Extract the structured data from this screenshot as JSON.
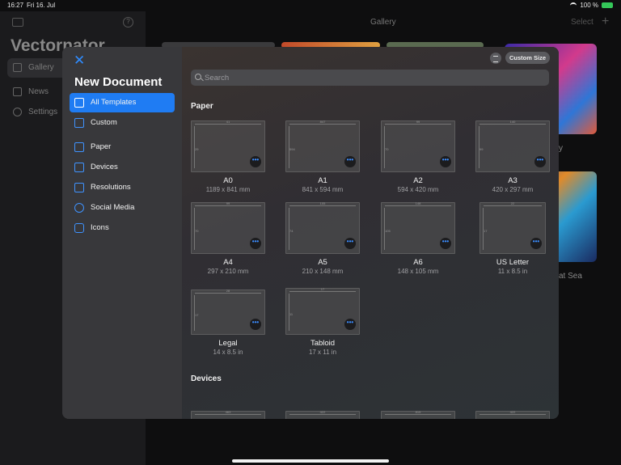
{
  "status": {
    "time": "16:27",
    "date": "Fri 16. Jul",
    "battery": "100 %"
  },
  "app": {
    "title": "Vectornator",
    "nav": [
      {
        "label": "Gallery"
      },
      {
        "label": "News"
      },
      {
        "label": "Settings"
      }
    ],
    "gallery_title": "Gallery",
    "select_label": "Select",
    "help_icon": "?",
    "plus_icon": "+",
    "partial_captions": [
      "y",
      "at Sea"
    ]
  },
  "modal": {
    "close_icon": "✕",
    "title": "New Document",
    "categories": [
      {
        "label": "All Templates",
        "icon": "grid-icon"
      },
      {
        "label": "Custom",
        "icon": "doc-icon"
      },
      {
        "label": "Paper",
        "icon": "paper-icon"
      },
      {
        "label": "Devices",
        "icon": "monitor-icon"
      },
      {
        "label": "Resolutions",
        "icon": "resolution-icon"
      },
      {
        "label": "Social Media",
        "icon": "person-icon"
      },
      {
        "label": "Icons",
        "icon": "app-icon"
      }
    ],
    "custom_size_label": "Custom Size",
    "search_placeholder": "Search",
    "sections": [
      {
        "label": "Paper"
      },
      {
        "label": "Devices"
      }
    ],
    "more_icon": "•••",
    "templates": [
      {
        "name": "A0",
        "size": "1189 x 841 mm",
        "dim_w": "41",
        "dim_h": "29"
      },
      {
        "name": "A1",
        "size": "841 x 594 mm",
        "dim_w": "847",
        "dim_h": "594"
      },
      {
        "name": "A2",
        "size": "594 x 420 mm",
        "dim_w": "99",
        "dim_h": "70"
      },
      {
        "name": "A3",
        "size": "420 x 297 mm",
        "dim_w": "140",
        "dim_h": "99"
      },
      {
        "name": "A4",
        "size": "297 x 210 mm",
        "dim_w": "99",
        "dim_h": "70"
      },
      {
        "name": "A5",
        "size": "210 x 148 mm",
        "dim_w": "105",
        "dim_h": "74"
      },
      {
        "name": "A6",
        "size": "148 x 105 mm",
        "dim_w": "148",
        "dim_h": "105"
      },
      {
        "name": "US Letter",
        "size": "11 x 8.5 in",
        "dim_w": "22",
        "dim_h": "17"
      },
      {
        "name": "Legal",
        "size": "14 x 8.5 in",
        "dim_w": "28",
        "dim_h": "17"
      },
      {
        "name": "Tabloid",
        "size": "17 x 11 in",
        "dim_w": "17",
        "dim_h": "11"
      }
    ],
    "device_dims": [
      "463",
      "422",
      "815",
      "422"
    ]
  }
}
